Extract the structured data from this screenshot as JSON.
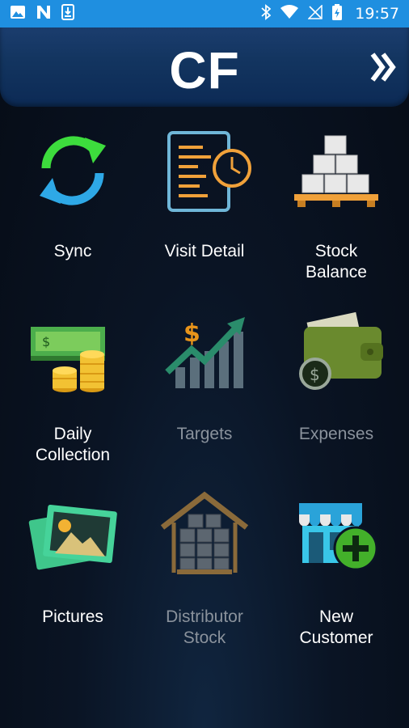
{
  "status_bar": {
    "time": "19:57",
    "left_icons": [
      "image-icon",
      "n-icon",
      "download-icon"
    ],
    "right_icons": [
      "bluetooth-icon",
      "wifi-icon",
      "no-signal-icon",
      "battery-icon"
    ]
  },
  "header": {
    "title": "CF",
    "next_icon": "double-chevron-right-icon"
  },
  "menu": [
    {
      "line1": "Sync",
      "line2": "",
      "enabled": true,
      "icon": "sync-icon"
    },
    {
      "line1": "Visit Detail",
      "line2": "",
      "enabled": true,
      "icon": "visit-detail-icon"
    },
    {
      "line1": "Stock",
      "line2": "Balance",
      "enabled": true,
      "icon": "stock-balance-icon"
    },
    {
      "line1": "Daily",
      "line2": "Collection",
      "enabled": true,
      "icon": "daily-collection-icon"
    },
    {
      "line1": "Targets",
      "line2": "",
      "enabled": false,
      "icon": "targets-icon"
    },
    {
      "line1": "Expenses",
      "line2": "",
      "enabled": false,
      "icon": "expenses-icon"
    },
    {
      "line1": "Pictures",
      "line2": "",
      "enabled": true,
      "icon": "pictures-icon"
    },
    {
      "line1": "Distributor",
      "line2": "Stock",
      "enabled": false,
      "icon": "distributor-stock-icon"
    },
    {
      "line1": "New",
      "line2": "Customer",
      "enabled": true,
      "icon": "new-customer-icon"
    }
  ],
  "colors": {
    "status_bar": "#1f8fe0",
    "header": "#133560",
    "enabled_label": "#ffffff",
    "disabled_label": "#8a929c"
  }
}
